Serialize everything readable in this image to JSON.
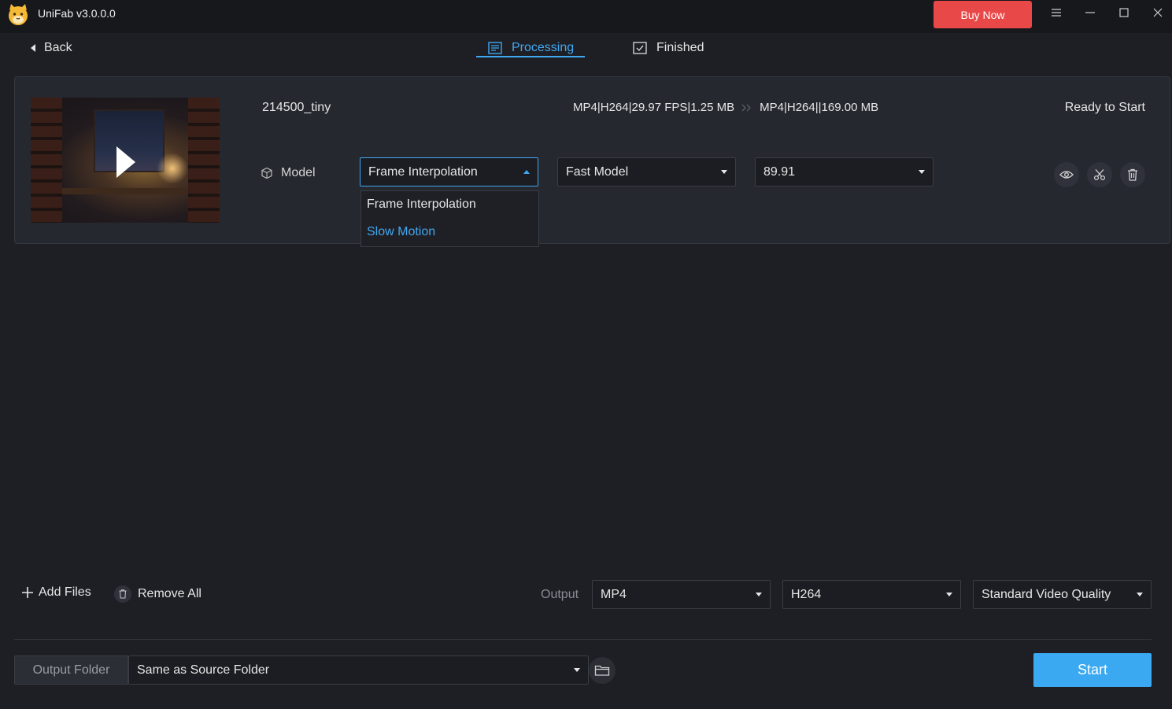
{
  "app": {
    "title": "UniFab v3.0.0.0",
    "buy_now_label": "Buy Now"
  },
  "nav": {
    "back_label": "Back",
    "tabs": [
      {
        "label": "Processing",
        "active": true
      },
      {
        "label": "Finished",
        "active": false
      }
    ]
  },
  "task": {
    "filename": "214500_tiny",
    "source_format": "MP4|H264|29.97 FPS|1.25 MB",
    "target_format": "MP4|H264||169.00 MB",
    "status": "Ready to Start",
    "model_label": "Model",
    "model_select": "Frame Interpolation",
    "speed_select": "Fast Model",
    "value_select": "89.91",
    "model_options": [
      {
        "label": "Frame Interpolation",
        "highlighted": false
      },
      {
        "label": "Slow Motion",
        "highlighted": true
      }
    ]
  },
  "toolbar": {
    "add_files_label": "Add Files",
    "remove_all_label": "Remove All",
    "output_label": "Output",
    "format_select": "MP4",
    "codec_select": "H264",
    "quality_select": "Standard Video Quality"
  },
  "footer": {
    "output_folder_label": "Output Folder",
    "folder_select": "Same as Source Folder",
    "start_label": "Start"
  },
  "colors": {
    "accent": "#41a7ef",
    "buy_now": "#e94848",
    "start": "#3aa9f2",
    "background": "#1e1f25"
  }
}
